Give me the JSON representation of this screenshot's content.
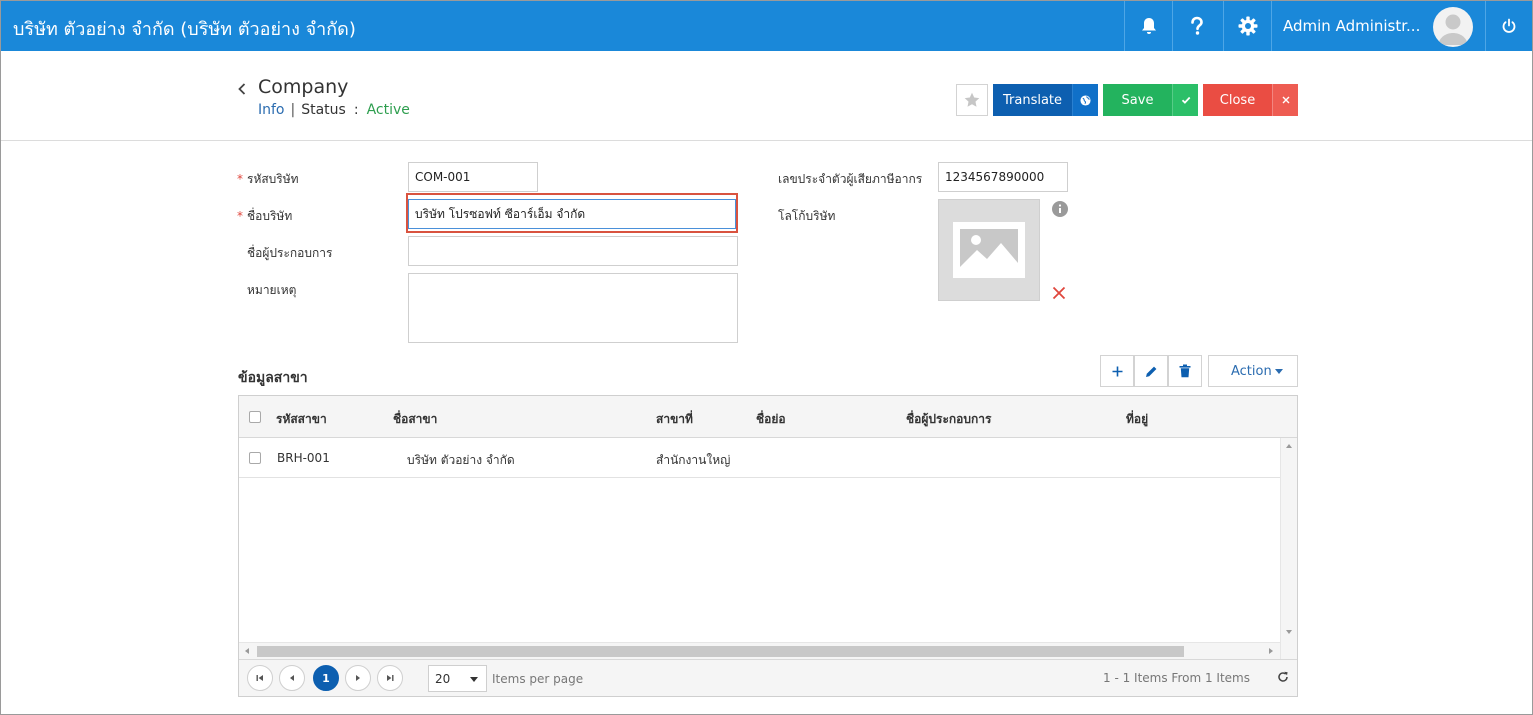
{
  "topbar": {
    "app_title": "บริษัท ตัวอย่าง จำกัด (บริษัท ตัวอย่าง จำกัด)",
    "user_name": "Admin Administr...",
    "color": "#1a88d9"
  },
  "header": {
    "title": "Company",
    "info_link": "Info",
    "separator": "|",
    "status_label": "Status",
    "colon": ":",
    "status_value": "Active",
    "buttons": {
      "translate": "Translate",
      "save": "Save",
      "close": "Close"
    }
  },
  "form": {
    "company_code": {
      "required": "*",
      "label": "รหัสบริษัท",
      "value": "COM-001"
    },
    "company_name": {
      "required": "*",
      "label": "ชื่อบริษัท",
      "value": "บริษัท โปรซอฟท์ ซีอาร์เอ็ม จำกัด"
    },
    "operator_name": {
      "label": "ชื่อผู้ประกอบการ",
      "value": ""
    },
    "remark": {
      "label": "หมายเหตุ",
      "value": ""
    },
    "tax_id": {
      "label": "เลขประจำตัวผู้เสียภาษีอากร",
      "value": "1234567890000"
    },
    "logo": {
      "label": "โลโก้บริษัท"
    }
  },
  "branch": {
    "title": "ข้อมูลสาขา",
    "action_label": "Action",
    "columns": [
      "รหัสสาขา",
      "ชื่อสาขา",
      "สาขาที่",
      "ชื่อย่อ",
      "ชื่อผู้ประกอบการ",
      "ที่อยู่"
    ],
    "rows": [
      {
        "code": "BRH-001",
        "name": "บริษัท ตัวอย่าง จำกัด",
        "branch_no": "สำนักงานใหญ่",
        "short_name": "",
        "operator": "",
        "address": ""
      }
    ],
    "pager": {
      "current_page": "1",
      "page_size": "20",
      "items_per_page_label": "Items per page",
      "summary": "1 - 1 Items From 1 Items"
    }
  },
  "colors": {
    "translate": "#0d5fb0",
    "save": "#23b35e",
    "close": "#ea4d43",
    "status_active": "#2e9e4f",
    "required_marker": "#e0463c",
    "focus_outline": "#d9533f"
  },
  "icons": [
    "bell-icon",
    "help-icon",
    "gear-icon",
    "power-icon",
    "back-chevron-icon",
    "star-icon",
    "globe-icon",
    "check-icon",
    "close-icon",
    "image-placeholder-icon",
    "info-icon",
    "remove-icon",
    "plus-icon",
    "pencil-icon",
    "trash-icon",
    "refresh-icon"
  ]
}
